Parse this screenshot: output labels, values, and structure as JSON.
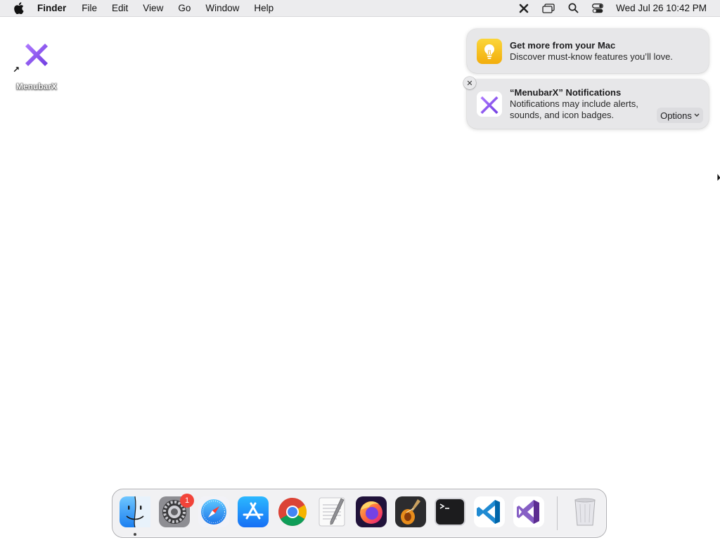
{
  "menubar": {
    "app_name": "Finder",
    "menus": [
      "File",
      "Edit",
      "View",
      "Go",
      "Window",
      "Help"
    ],
    "status_icons": [
      "menubarx-icon",
      "screen-mirroring-icon",
      "spotlight-search-icon",
      "control-center-icon"
    ],
    "clock": "Wed Jul 26  10:42 PM"
  },
  "desktop": {
    "icons": [
      {
        "label": "MenubarX",
        "icon": "menubarx-icon",
        "is_alias": true
      }
    ]
  },
  "notifications": [
    {
      "title": "Get more from your Mac",
      "body": "Discover must-know features you’ll love.",
      "icon": "tips-lightbulb-icon"
    },
    {
      "title": "“MenubarX” Notifications",
      "body": "Notifications may include alerts, sounds, and icon badges.",
      "icon": "menubarx-icon",
      "options_label": "Options",
      "close_label": "✕"
    }
  ],
  "dock": {
    "apps": [
      {
        "name": "Finder",
        "icon": "finder-icon",
        "running": true
      },
      {
        "name": "System Settings",
        "icon": "system-settings-icon",
        "badge": "1"
      },
      {
        "name": "Safari",
        "icon": "safari-icon"
      },
      {
        "name": "App Store",
        "icon": "app-store-icon"
      },
      {
        "name": "Google Chrome",
        "icon": "chrome-icon"
      },
      {
        "name": "TextEdit",
        "icon": "textedit-icon"
      },
      {
        "name": "Firefox",
        "icon": "firefox-icon"
      },
      {
        "name": "GarageBand",
        "icon": "garageband-icon"
      },
      {
        "name": "Terminal",
        "icon": "terminal-icon"
      },
      {
        "name": "Visual Studio Code",
        "icon": "vscode-icon"
      },
      {
        "name": "Visual Studio",
        "icon": "visual-studio-icon"
      }
    ],
    "trash": {
      "name": "Trash",
      "icon": "trash-icon"
    }
  },
  "colors": {
    "menubar_bg": "#ececee",
    "notification_bg": "#e7e7e9",
    "badge_red": "#f2443a",
    "menubarx_purple": "#8a4ff0",
    "tips_yellow": "#f7c21a"
  }
}
